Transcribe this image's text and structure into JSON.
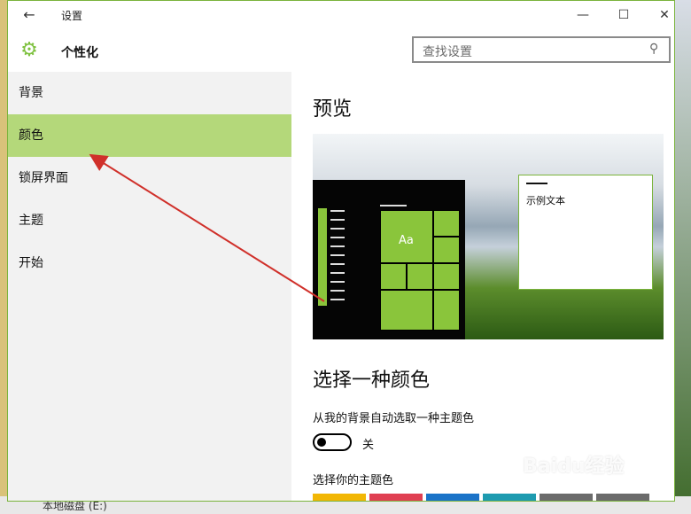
{
  "window": {
    "title": "设置",
    "back_icon": "back-arrow-icon",
    "controls": {
      "minimize": "—",
      "maximize": "☐",
      "close": "✕"
    }
  },
  "header": {
    "icon": "gear-icon",
    "title": "个性化",
    "search_placeholder": "查找设置"
  },
  "sidebar": {
    "items": [
      {
        "label": "背景",
        "active": false
      },
      {
        "label": "颜色",
        "active": true
      },
      {
        "label": "锁屏界面",
        "active": false
      },
      {
        "label": "主题",
        "active": false
      },
      {
        "label": "开始",
        "active": false
      }
    ]
  },
  "content": {
    "preview_heading": "预览",
    "preview": {
      "tile_text": "Aa",
      "sample_text": "示例文本"
    },
    "choose_color_heading": "选择一种颜色",
    "auto_pick_label": "从我的背景自动选取一种主题色",
    "toggle_state": "关",
    "accent_label": "选择你的主题色",
    "swatches": [
      "#f2b705",
      "#e03f52",
      "#1b73c8",
      "#1e9bb0",
      "#6b6b6b",
      "#6b6b6b"
    ]
  },
  "desktop": {
    "bottom_text": "本地磁盘 (E:)",
    "watermark": "Baidu经验"
  },
  "colors": {
    "accent": "#8ac53b",
    "sidebar_active": "#b4d87a",
    "arrow": "#d0302a"
  }
}
